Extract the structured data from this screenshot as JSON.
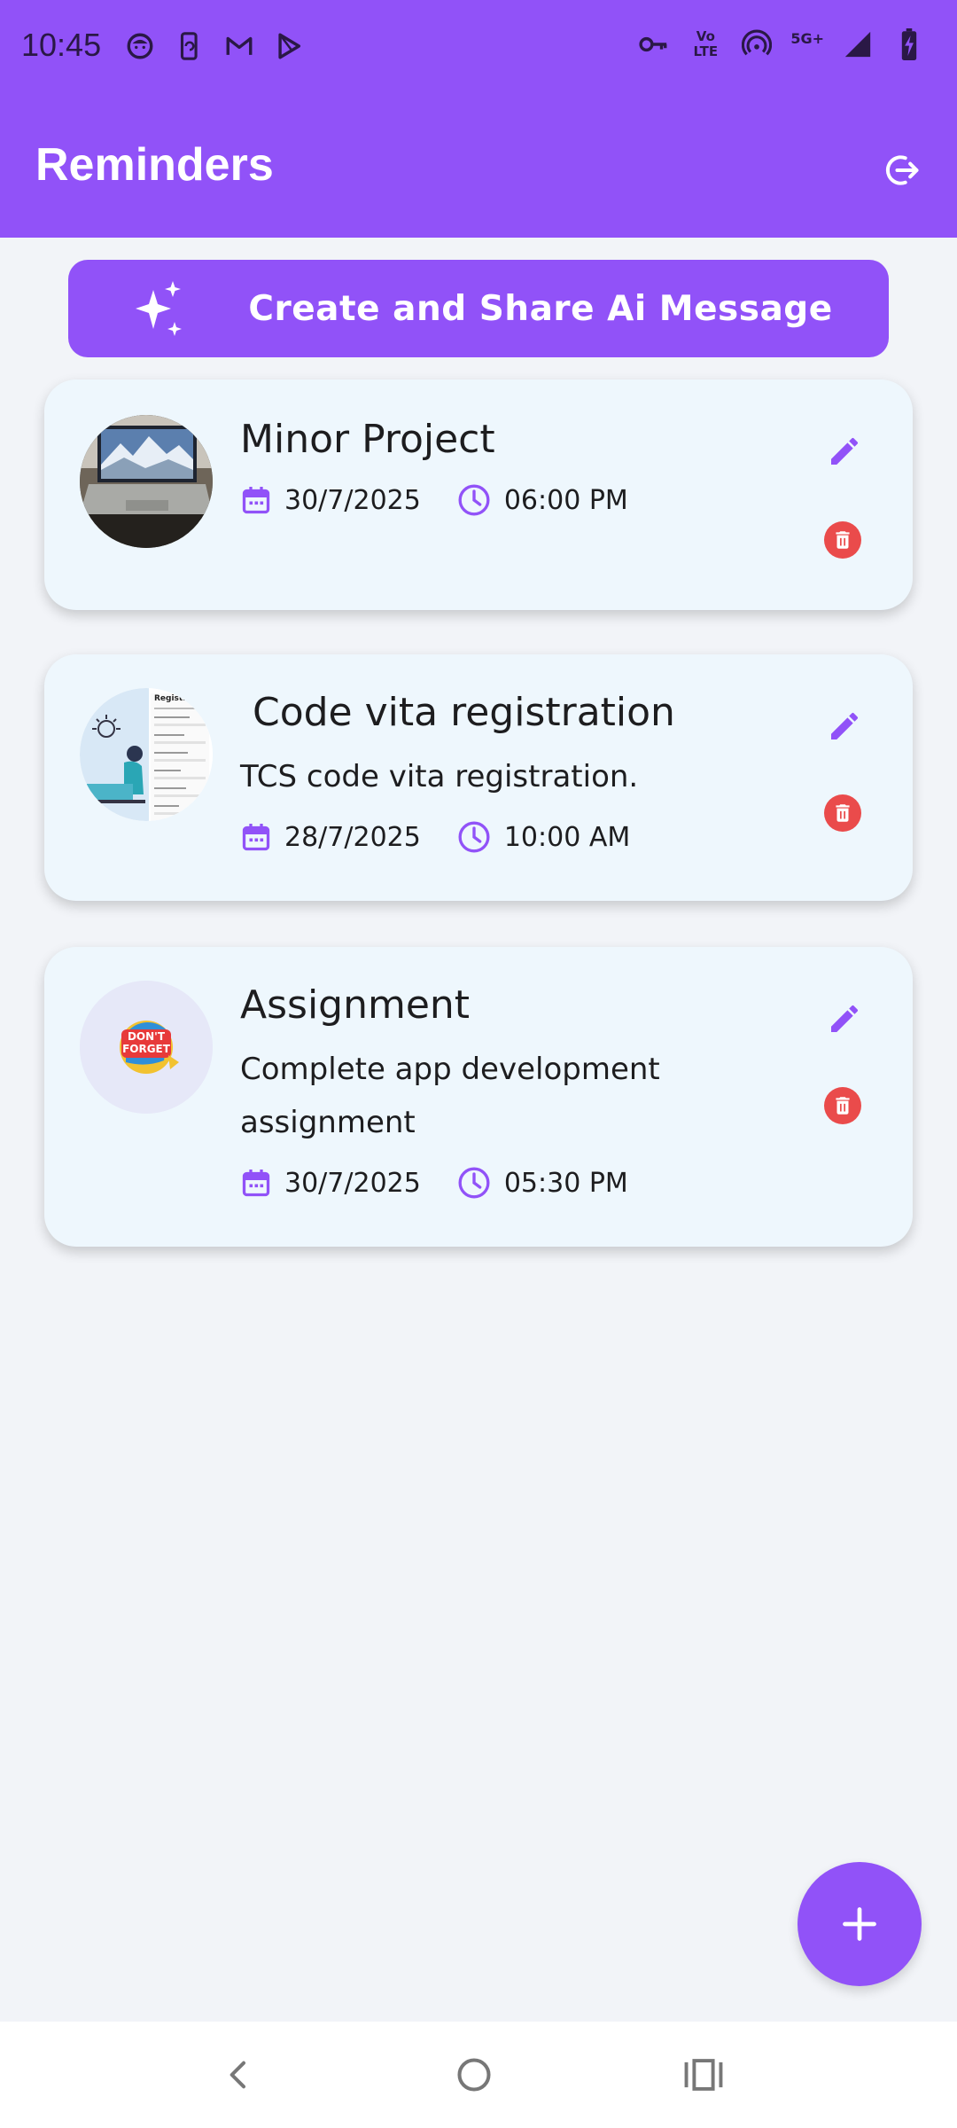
{
  "status_bar": {
    "time": "10:45",
    "left_icons": [
      "face-icon",
      "phone-sync-icon",
      "gmail-icon",
      "play-icon"
    ],
    "right_icons": [
      "vpn-key-icon",
      "volte-icon",
      "hotspot-icon",
      "5g-icon",
      "signal-icon",
      "battery-charging-icon"
    ],
    "volte_text": "Vo LTE",
    "network_text": "5G+"
  },
  "app_bar": {
    "title": "Reminders",
    "logout_icon": "logout-icon"
  },
  "ai_button": {
    "label": "Create and Share Ai Message",
    "icon": "sparkle-icon"
  },
  "reminders": [
    {
      "title": "Minor Project",
      "description": "",
      "date": "30/7/2025",
      "time": "06:00 PM",
      "thumbnail": "laptop-photo"
    },
    {
      "title": " Code vita registration",
      "description": "TCS code vita registration.",
      "date": "28/7/2025",
      "time": "10:00 AM",
      "thumbnail": "registration-illustration"
    },
    {
      "title": "Assignment",
      "description": "Complete app development assignment",
      "date": "30/7/2025",
      "time": "05:30 PM",
      "thumbnail": "dont-forget-badge",
      "thumbnail_text": "DON'T FORGET"
    }
  ],
  "fab": {
    "icon": "plus-icon"
  },
  "nav_bar": {
    "icons": [
      "back-icon",
      "home-icon",
      "recents-icon"
    ]
  },
  "colors": {
    "primary": "#9152f8",
    "card_background": "#eef7fd",
    "page_background": "#f2f4f8",
    "delete_red": "#ea4b4b"
  }
}
